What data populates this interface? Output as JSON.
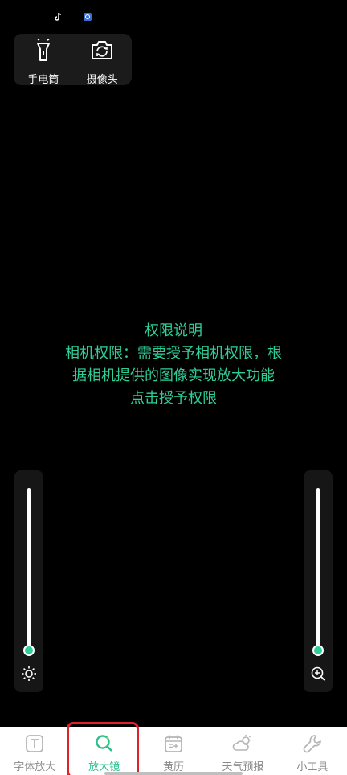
{
  "status_bar": {
    "icons": [
      "tiktok-icon",
      "app-icon"
    ]
  },
  "quick_panel": {
    "flashlight_label": "手电筒",
    "camera_label": "摄像头"
  },
  "permission": {
    "title": "权限说明",
    "line1": "相机权限：需要授予相机权限，根",
    "line2": "据相机提供的图像实现放大功能",
    "action": "点击授予权限"
  },
  "brightness_slider": {
    "level": 0,
    "icon": "sun-icon"
  },
  "zoom_slider": {
    "level": 0,
    "icon": "zoom-in-icon"
  },
  "bottom_nav": {
    "items": [
      {
        "label": "字体放大",
        "icon": "text-icon"
      },
      {
        "label": "放大镜",
        "icon": "magnifier-icon"
      },
      {
        "label": "黄历",
        "icon": "calendar-icon"
      },
      {
        "label": "天气预报",
        "icon": "weather-icon"
      },
      {
        "label": "小工具",
        "icon": "wrench-icon"
      }
    ],
    "active_index": 1
  },
  "colors": {
    "accent": "#2fcf98",
    "highlight": "#e0212b",
    "background": "#000000"
  }
}
